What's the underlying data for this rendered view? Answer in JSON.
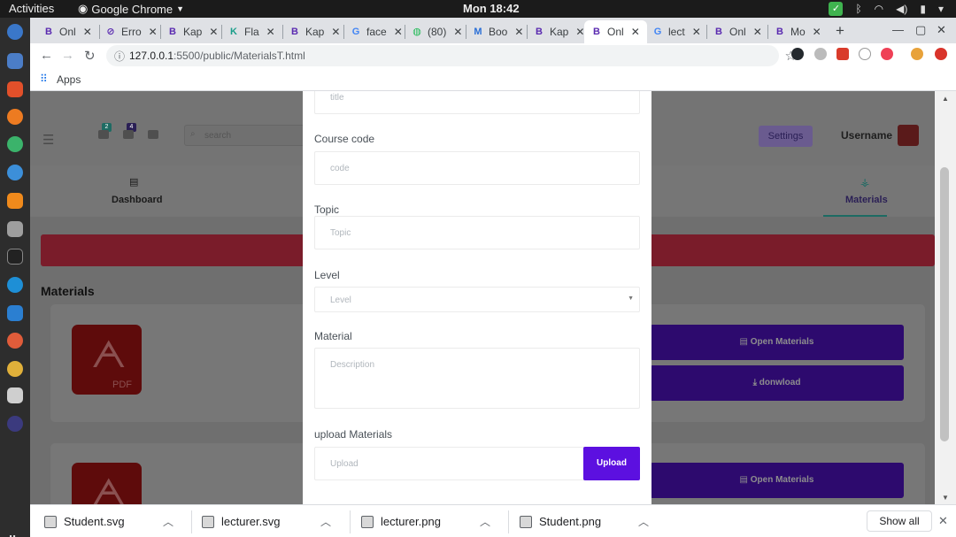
{
  "os": {
    "activities": "Activities",
    "app_name": "Google Chrome",
    "clock": "Mon 18:42"
  },
  "browser": {
    "tabs": [
      {
        "fav": "B",
        "title": "Onl"
      },
      {
        "fav": "⊘",
        "title": "Erro"
      },
      {
        "fav": "B",
        "title": "Kap"
      },
      {
        "fav": "K",
        "title": "Fla"
      },
      {
        "fav": "B",
        "title": "Kap"
      },
      {
        "fav": "G",
        "title": "face"
      },
      {
        "fav": "◍",
        "title": "(80)"
      },
      {
        "fav": "M",
        "title": "Boo"
      },
      {
        "fav": "B",
        "title": "Kap"
      },
      {
        "fav": "B",
        "title": "Onl"
      },
      {
        "fav": "G",
        "title": "lect"
      },
      {
        "fav": "B",
        "title": "Onl"
      },
      {
        "fav": "B",
        "title": "Mo"
      }
    ],
    "url_host": "127.0.0.1",
    "url_path": ":5500/public/MaterialsT.html",
    "bookmarks_apps": "Apps"
  },
  "page": {
    "search_placeholder": "search",
    "badge_1": "2",
    "badge_2": "4",
    "settings_label": "Settings",
    "username": "Username",
    "nav_dashboard": "Dashboard",
    "nav_materials": "Materials",
    "section_title": "Materials",
    "pdf_label": "PDF",
    "open_materials": "Open Materials",
    "download": "donwload",
    "colors": {
      "accent": "#5c10e0",
      "alert": "#e8304e",
      "teal": "#1d9b8e"
    }
  },
  "modal": {
    "title_placeholder": "title",
    "course_code_label": "Course code",
    "course_code_placeholder": "code",
    "topic_label": "Topic",
    "topic_placeholder": "Topic",
    "level_label": "Level",
    "level_placeholder": "Level",
    "material_label": "Material",
    "material_placeholder": "Description",
    "upload_label": "upload Materials",
    "upload_placeholder": "Upload",
    "upload_button": "Upload"
  },
  "downloads": {
    "items": [
      "Student.svg",
      "lecturer.svg",
      "lecturer.png",
      "Student.png"
    ],
    "show_all": "Show all"
  }
}
